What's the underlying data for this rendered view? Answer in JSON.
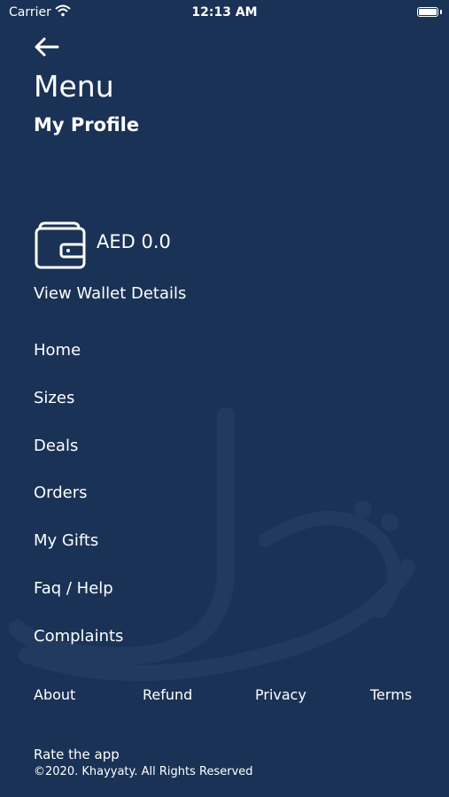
{
  "status_bar": {
    "carrier": "Carrier",
    "time": "12:13 AM"
  },
  "header": {
    "title": "Menu",
    "profile_label": "My Profile"
  },
  "wallet": {
    "amount": "AED 0.0",
    "details_label": "View Wallet Details"
  },
  "nav": {
    "items": [
      {
        "label": "Home"
      },
      {
        "label": "Sizes"
      },
      {
        "label": "Deals"
      },
      {
        "label": "Orders"
      },
      {
        "label": "My Gifts"
      },
      {
        "label": "Faq / Help"
      },
      {
        "label": "Complaints"
      }
    ]
  },
  "footer": {
    "links": [
      {
        "label": "About"
      },
      {
        "label": "Refund"
      },
      {
        "label": "Privacy"
      },
      {
        "label": "Terms"
      }
    ],
    "rate_label": "Rate the app",
    "copyright": "©2020. Khayyaty. All Rights Reserved"
  },
  "colors": {
    "background": "#1a3256",
    "text": "#ffffff"
  },
  "icons": {
    "back": "arrow-left-icon",
    "wallet": "wallet-icon",
    "wifi": "wifi-icon",
    "battery": "battery-icon"
  }
}
